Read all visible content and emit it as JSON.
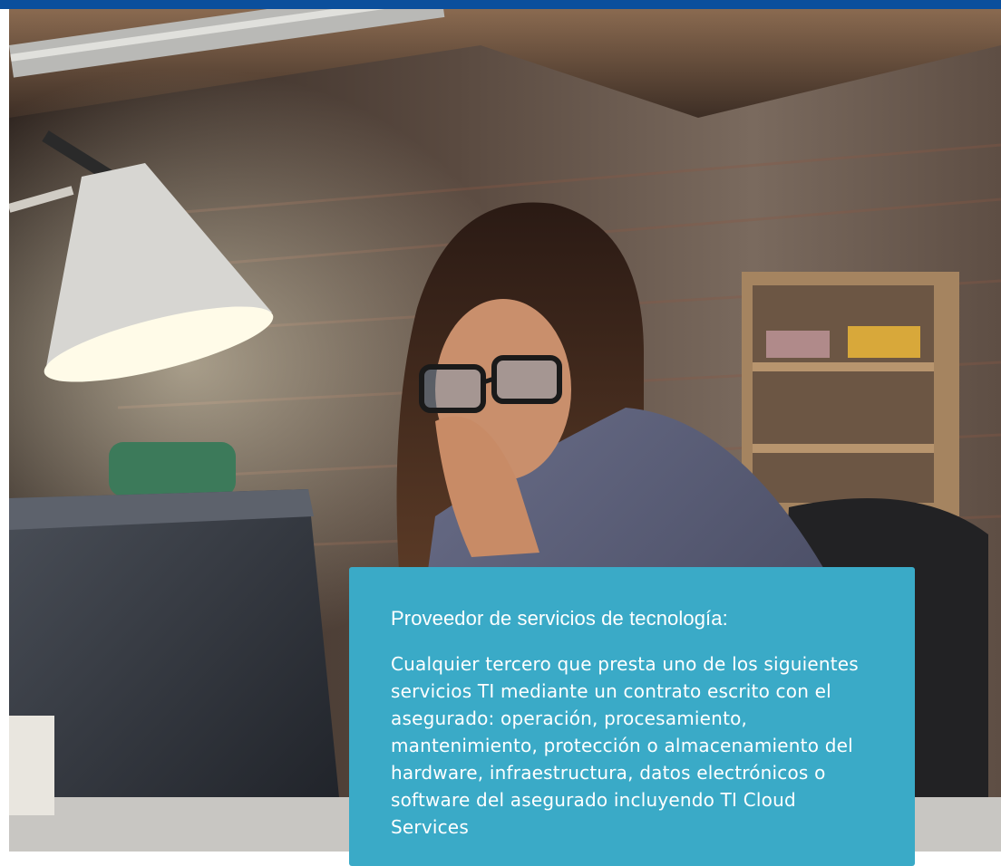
{
  "callout": {
    "title": "Proveedor de servicios de tecnología:",
    "body": "Cualquier tercero que presta uno de los siguientes servicios TI mediante un contrato escrito con el asegurado: operación, procesamiento, mantenimiento, protección o almacenamiento del hardware, infraestructura, datos electrónicos o software del asegurado incluyendo TI Cloud Services"
  },
  "colors": {
    "top_bar": "#0b4f9c",
    "callout_background": "#3aaac7",
    "callout_text": "#ffffff"
  },
  "photo": {
    "subject": "woman with glasses at desk looking at laptop under a desk lamp"
  }
}
